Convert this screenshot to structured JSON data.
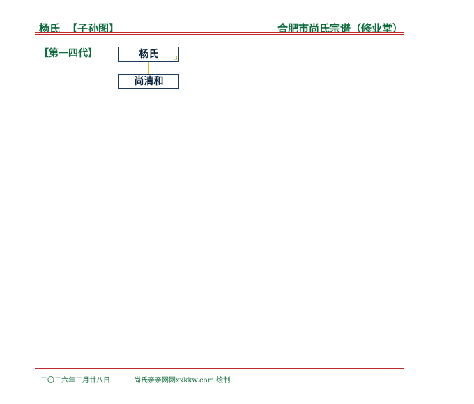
{
  "header": {
    "left_name": "杨氏",
    "left_tag": "【子孙图】",
    "right_title": "合肥市尚氏宗谱（修业堂）"
  },
  "generation": {
    "label": "【第一四代】"
  },
  "tree": {
    "parent": {
      "name": "杨氏",
      "marker": "3"
    },
    "child": {
      "name": "尚清和"
    }
  },
  "footer": {
    "date": "二〇二六年二月廿八日",
    "credit": "尚氏亲亲网网xxkkw.com 绘制"
  },
  "colors": {
    "heading_green": "#0c6b3a",
    "rule_red": "#c0282b",
    "connector_yellow": "#e8b820",
    "box_border": "#1b3a5c"
  }
}
